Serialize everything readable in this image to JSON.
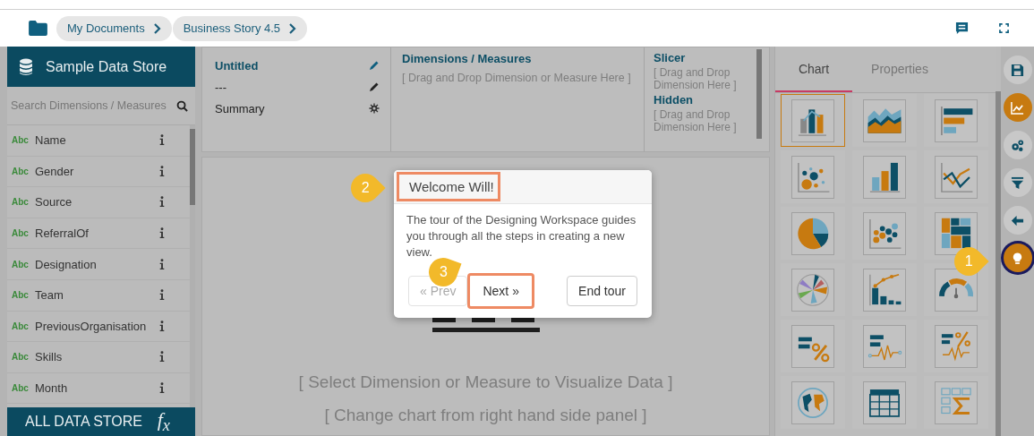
{
  "breadcrumbs": [
    {
      "label": "My Documents"
    },
    {
      "label": "Business Story 4.5"
    }
  ],
  "data_store": {
    "title": "Sample Data Store",
    "search": {
      "placeholder": "Search Dimensions / Measures"
    },
    "fields": [
      {
        "type": "Abc",
        "name": "Name"
      },
      {
        "type": "Abc",
        "name": "Gender"
      },
      {
        "type": "Abc",
        "name": "Source"
      },
      {
        "type": "Abc",
        "name": "ReferralOf"
      },
      {
        "type": "Abc",
        "name": "Designation"
      },
      {
        "type": "Abc",
        "name": "Team"
      },
      {
        "type": "Abc",
        "name": "PreviousOrganisation"
      },
      {
        "type": "Abc",
        "name": "Skills"
      },
      {
        "type": "Abc",
        "name": "Month"
      }
    ],
    "footer": {
      "label": "ALL DATA STORE",
      "function_label": "f$_{x}$"
    }
  },
  "view": {
    "title": "Untitled",
    "subtitle": "---",
    "summary": "Summary"
  },
  "wells": [
    {
      "title": "Dimensions / Measures",
      "hint": "[ Drag and Drop Dimension or Measure Here ]"
    },
    {
      "title": "Slicer",
      "hint": "[ Drag and Drop Dimension Here ]"
    },
    {
      "title": "Hidden",
      "hint": "[ Drag and Drop Dimension Here ]"
    }
  ],
  "canvas": {
    "messages": [
      "[ Select Dimension or Measure to Visualize Data ]",
      "[ Change chart from right hand side panel ]"
    ]
  },
  "panel_tabs": [
    {
      "label": "Chart",
      "selected": true
    },
    {
      "label": "Properties",
      "selected": false
    }
  ],
  "chart_types": [
    {
      "kind": "combo",
      "selected": true
    },
    {
      "kind": "area",
      "selected": false
    },
    {
      "kind": "hbar",
      "selected": false
    },
    {
      "kind": "bubble",
      "selected": false
    },
    {
      "kind": "column",
      "selected": false
    },
    {
      "kind": "line",
      "selected": false
    },
    {
      "kind": "pie",
      "selected": false
    },
    {
      "kind": "cluster",
      "selected": false
    },
    {
      "kind": "treemap",
      "selected": false
    },
    {
      "kind": "rose",
      "selected": false
    },
    {
      "kind": "pareto",
      "selected": false
    },
    {
      "kind": "gauge",
      "selected": false
    },
    {
      "kind": "kpi",
      "selected": false
    },
    {
      "kind": "trend",
      "selected": false
    },
    {
      "kind": "kpitrend",
      "selected": false
    },
    {
      "kind": "map",
      "selected": false
    },
    {
      "kind": "table",
      "selected": false
    },
    {
      "kind": "pivot",
      "selected": false
    }
  ],
  "rail": [
    {
      "kind": "save",
      "selected": false,
      "highlighted": false
    },
    {
      "kind": "chart",
      "selected": true,
      "highlighted": false
    },
    {
      "kind": "settings",
      "selected": false,
      "highlighted": false
    },
    {
      "kind": "filter",
      "selected": false,
      "highlighted": false
    },
    {
      "kind": "back",
      "selected": false,
      "highlighted": false
    },
    {
      "kind": "tips",
      "selected": true,
      "highlighted": true
    }
  ],
  "tour": {
    "title": "Welcome Will!",
    "title_highlighted": true,
    "text": "The tour of the Designing Workspace guides you through all the steps in creating a new view.",
    "buttons": [
      {
        "label": "« Prev",
        "disabled": true,
        "highlighted": false
      },
      {
        "label": "Next »",
        "disabled": false,
        "highlighted": true
      },
      {
        "label": "End tour",
        "disabled": false,
        "highlighted": false
      }
    ]
  },
  "step_badges": [
    {
      "number": "1"
    },
    {
      "number": "2"
    },
    {
      "number": "3"
    }
  ]
}
